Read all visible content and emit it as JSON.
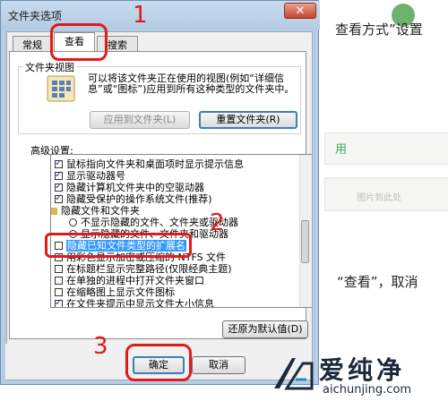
{
  "background": {
    "line1": "查看方式”设置",
    "green_text": "用",
    "hint_text": "图片到此处",
    "line2": "“查看”，取消"
  },
  "dialog": {
    "title": "文件夹选项",
    "close_glyph": "✕",
    "tabs": [
      {
        "label": "常规"
      },
      {
        "label": "查看",
        "active": true
      },
      {
        "label": "搜索"
      }
    ],
    "folder_view": {
      "title": "文件夹视图",
      "description": "可以将该文件夹正在使用的视图(例如“详细信息”或“图标”)应用到所有这种类型的文件夹中。",
      "apply_button": "应用到文件夹(L)",
      "reset_button": "重置文件夹(R)"
    },
    "advanced_label": "高级设置:",
    "advanced_items": [
      {
        "type": "checkbox",
        "checked": true,
        "label": "鼠标指向文件夹和桌面项时显示提示信息"
      },
      {
        "type": "checkbox",
        "checked": true,
        "label": "显示驱动器号"
      },
      {
        "type": "checkbox",
        "checked": true,
        "label": "隐藏计算机文件夹中的空驱动器"
      },
      {
        "type": "checkbox",
        "checked": true,
        "label": "隐藏受保护的操作系统文件(推荐)"
      },
      {
        "type": "folder",
        "label": "隐藏文件和文件夹"
      },
      {
        "type": "radio",
        "checked": false,
        "label": "不显示隐藏的文件、文件夹或驱动器"
      },
      {
        "type": "radio",
        "checked": true,
        "label": "显示隐藏的文件、文件夹和驱动器"
      },
      {
        "type": "checkbox",
        "checked": false,
        "label": "隐藏已知文件类型的扩展名",
        "highlight": true
      },
      {
        "type": "checkbox",
        "checked": true,
        "label": "用彩色显示加密或压缩的 NTFS 文件"
      },
      {
        "type": "checkbox",
        "checked": false,
        "label": "在标题栏显示完整路径(仅限经典主题)"
      },
      {
        "type": "checkbox",
        "checked": false,
        "label": "在单独的进程中打开文件夹窗口"
      },
      {
        "type": "checkbox",
        "checked": false,
        "label": "在缩略图上显示文件图标"
      },
      {
        "type": "checkbox",
        "checked": true,
        "label": "在文件夹提示中显示文件大小信息"
      }
    ],
    "restore_button": "还原为默认值(D)",
    "ok_button": "确定",
    "cancel_button": "取消"
  },
  "annotations": {
    "step1": "1",
    "step2": "2",
    "step3": "3"
  },
  "watermark": {
    "name": "爱纯净",
    "url": "aichunjing.com"
  }
}
